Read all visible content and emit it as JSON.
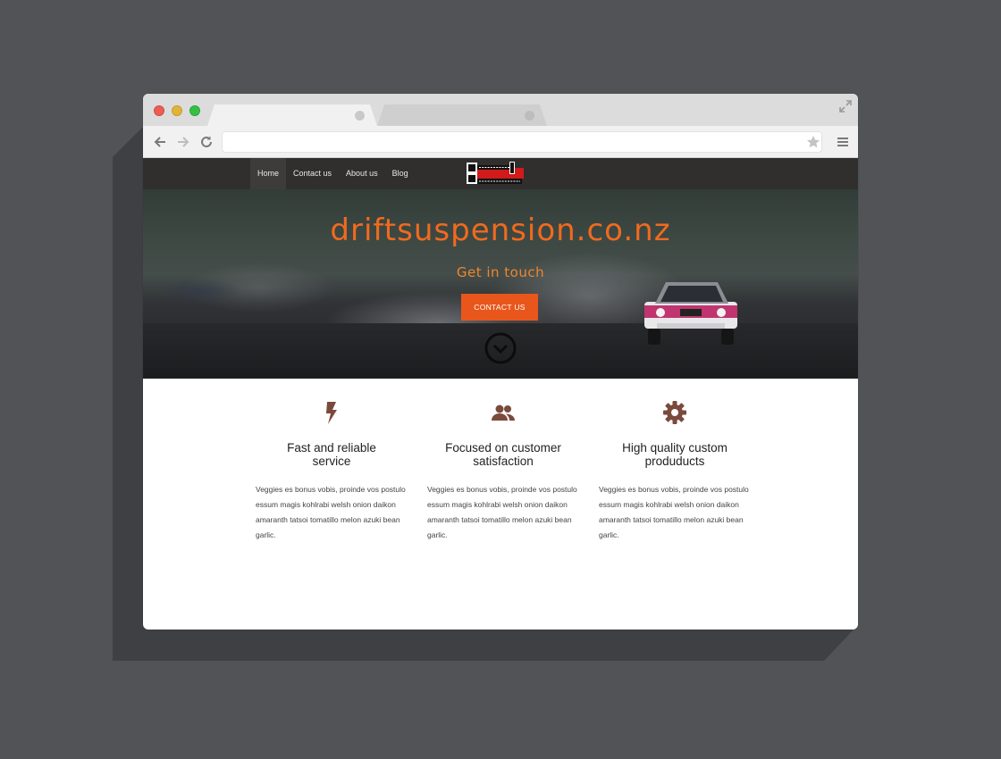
{
  "browser": {
    "window_controls": [
      "close",
      "minimize",
      "maximize"
    ],
    "tabs": [
      {
        "state": "active"
      },
      {
        "state": "inactive"
      }
    ],
    "url": ""
  },
  "site": {
    "nav": {
      "items": [
        {
          "label": "Home",
          "active": true
        },
        {
          "label": "Contact us",
          "active": false
        },
        {
          "label": "About us",
          "active": false
        },
        {
          "label": "Blog",
          "active": false
        }
      ]
    },
    "hero": {
      "title": "driftsuspension.co.nz",
      "subtitle": "Get in touch",
      "cta_label": "CONTACT US"
    },
    "features": [
      {
        "icon": "lightning-icon",
        "title_line1": "Fast and reliable",
        "title_line2": "service",
        "body": "Veggies es bonus vobis, proinde vos postulo essum magis kohlrabi welsh onion daikon amaranth tatsoi tomatillo melon azuki bean garlic."
      },
      {
        "icon": "users-icon",
        "title_line1": "Focused on customer",
        "title_line2": "satisfaction",
        "body": "Veggies es bonus vobis, proinde vos postulo essum magis kohlrabi welsh onion daikon amaranth tatsoi tomatillo melon azuki bean garlic."
      },
      {
        "icon": "gear-icon",
        "title_line1": "High quality custom",
        "title_line2": "produducts",
        "body": "Veggies es bonus vobis, proinde vos postulo essum magis kohlrabi welsh onion daikon amaranth tatsoi tomatillo melon azuki bean garlic."
      }
    ]
  },
  "colors": {
    "accent_orange": "#e9561b",
    "title_orange": "#f06a1e",
    "nav_bg": "#302f2d",
    "icon_brown": "#7a4a3c",
    "page_bg": "#525356"
  }
}
